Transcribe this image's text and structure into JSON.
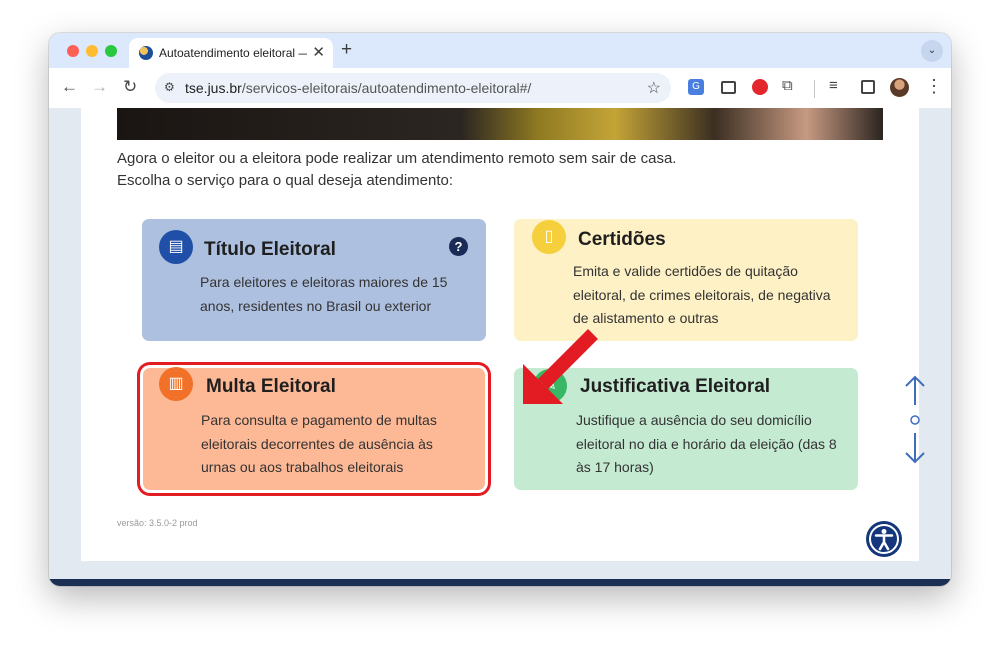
{
  "browser": {
    "tab_title": "Autoatendimento eleitoral — T",
    "tab_close": "✕",
    "new_tab": "+",
    "tab_search": "⌄",
    "url_host": "tse.jus.br",
    "url_path": "/servicos-eleitorais/autoatendimento-eleitoral#/",
    "nav_back": "←",
    "nav_forward": "→",
    "nav_reload": "↻",
    "star": "☆",
    "menu": "⋮"
  },
  "page": {
    "intro_line1": "Agora o eleitor ou a eleitora pode realizar um atendimento remoto sem sair de casa.",
    "intro_line2": "Escolha o serviço para o qual deseja atendimento:",
    "version": "versão: 3.5.0-2 prod"
  },
  "services": [
    {
      "title": "Título Eleitoral",
      "description": "Para eleitores e eleitoras maiores de 15 anos, residentes no Brasil ou exterior",
      "color": "#aec0e0",
      "icon_color": "#1f4fa6",
      "icon": "id-card-icon",
      "icon_glyph": "▤",
      "help_glyph": "?"
    },
    {
      "title": "Certidões",
      "description": "Emita e valide certidões de quitação eleitoral, de crimes eleitorais, de negativa de alistamento e outras",
      "color": "#fdf1c5",
      "icon_color": "#f5cf3c",
      "icon": "document-icon",
      "icon_glyph": "▯"
    },
    {
      "title": "Multa Eleitoral",
      "description": "Para consulta e pagamento de multas eleitorais decorrentes de ausência às urnas ou aos trabalhos eleitorais",
      "color": "#fdb996",
      "icon_color": "#f07127",
      "icon": "barcode-icon",
      "icon_glyph": "▥"
    },
    {
      "title": "Justificativa Eleitoral",
      "description": "Justifique a ausência do seu domicílio eleitoral no dia e horário da eleição (das 8 às 17 horas)",
      "color": "#c5ead2",
      "icon_color": "#38b865",
      "icon": "edit-document-icon",
      "icon_glyph": "✎"
    }
  ],
  "scroll_nav": {
    "up": "↑",
    "dot": "○",
    "down": "↓"
  },
  "colors": {
    "highlight_border": "#e31b22",
    "annotation_arrow": "#e31b22",
    "accessibility_button": "#14367a"
  }
}
